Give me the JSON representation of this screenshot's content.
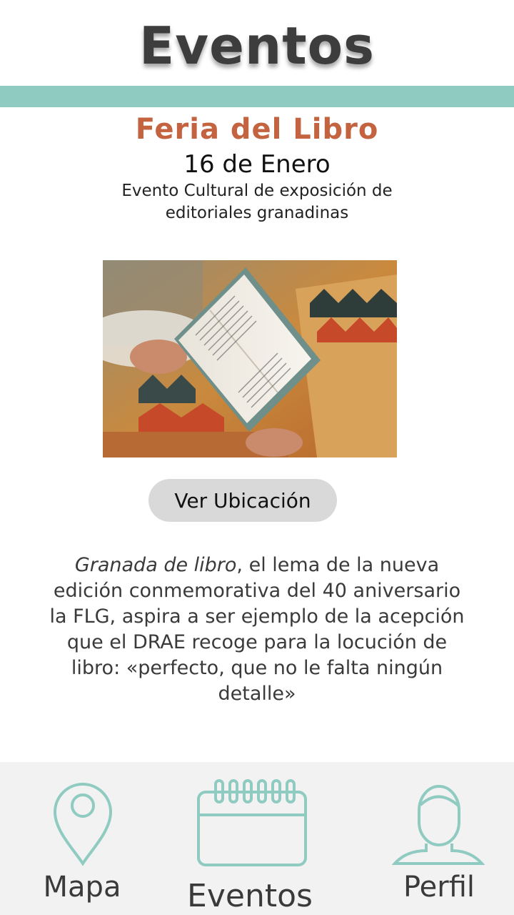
{
  "header": {
    "title": "Eventos"
  },
  "event": {
    "name": "Feria del Libro",
    "date": "16 de Enero",
    "summary": "Evento Cultural de exposición de editoriales granadinas",
    "location_button": "Ver Ubicación",
    "description_italic": "Granada de libro",
    "description_rest": ", el lema de la nueva edición conmemorativa del 40 aniversario la FLG, aspira a ser ejemplo de la acepción que el DRAE recoge para la locución de libro: «perfecto, que no le falta ningún detalle»"
  },
  "nav": {
    "items": [
      {
        "label": "Mapa",
        "icon": "map-pin-icon"
      },
      {
        "label": "Eventos",
        "icon": "calendar-icon"
      },
      {
        "label": "Perfil",
        "icon": "user-icon"
      }
    ]
  },
  "colors": {
    "accent": "#8fcbc1",
    "event_title": "#c3633f",
    "button_bg": "#d9d9d9",
    "nav_bg": "#f2f2f2",
    "icon_stroke": "#8fcbc1"
  }
}
